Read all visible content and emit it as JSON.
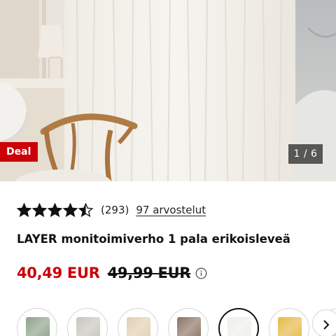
{
  "hero": {
    "image_icon": "sheer-curtain-photo",
    "deal_badge": "Deal",
    "image_counter": "1 / 6"
  },
  "rating": {
    "stars": 4.5,
    "max_stars": 5,
    "count": "(293)",
    "reviews_link": "97 arvostelut"
  },
  "product": {
    "title": "LAYER monitoimiverho 1 pala erikoisleveä"
  },
  "price": {
    "current": "40,49 EUR",
    "original": "49,99 EUR",
    "info_icon": "info-icon"
  },
  "swatches": {
    "items": [
      {
        "name": "sage-green",
        "color": "#8fa18c"
      },
      {
        "name": "light-grey",
        "color": "#c9c5bd"
      },
      {
        "name": "beige",
        "color": "#e2cfb0"
      },
      {
        "name": "brown",
        "color": "#8c7465"
      },
      {
        "name": "white",
        "color": "#eeeeec",
        "selected": true
      },
      {
        "name": "yellow",
        "color": "#e6b948"
      },
      {
        "name": "grey-blue",
        "color": "#b4bccb"
      }
    ],
    "next_icon": "chevron-right-icon"
  },
  "colors": {
    "brand_red": "#cc0008",
    "text": "#111111"
  }
}
